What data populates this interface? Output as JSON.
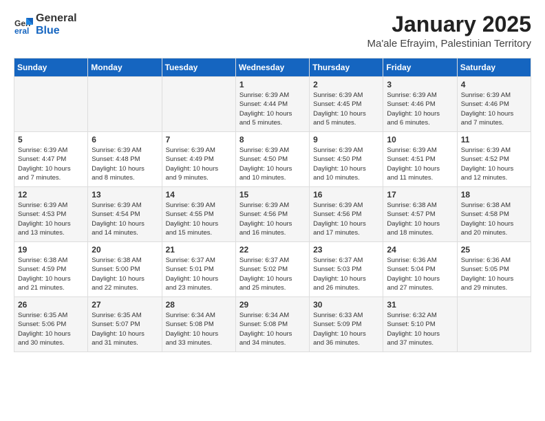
{
  "logo": {
    "general": "General",
    "blue": "Blue"
  },
  "header": {
    "month": "January 2025",
    "location": "Ma'ale Efrayim, Palestinian Territory"
  },
  "weekdays": [
    "Sunday",
    "Monday",
    "Tuesday",
    "Wednesday",
    "Thursday",
    "Friday",
    "Saturday"
  ],
  "weeks": [
    [
      {
        "day": "",
        "info": ""
      },
      {
        "day": "",
        "info": ""
      },
      {
        "day": "",
        "info": ""
      },
      {
        "day": "1",
        "info": "Sunrise: 6:39 AM\nSunset: 4:44 PM\nDaylight: 10 hours\nand 5 minutes."
      },
      {
        "day": "2",
        "info": "Sunrise: 6:39 AM\nSunset: 4:45 PM\nDaylight: 10 hours\nand 5 minutes."
      },
      {
        "day": "3",
        "info": "Sunrise: 6:39 AM\nSunset: 4:46 PM\nDaylight: 10 hours\nand 6 minutes."
      },
      {
        "day": "4",
        "info": "Sunrise: 6:39 AM\nSunset: 4:46 PM\nDaylight: 10 hours\nand 7 minutes."
      }
    ],
    [
      {
        "day": "5",
        "info": "Sunrise: 6:39 AM\nSunset: 4:47 PM\nDaylight: 10 hours\nand 7 minutes."
      },
      {
        "day": "6",
        "info": "Sunrise: 6:39 AM\nSunset: 4:48 PM\nDaylight: 10 hours\nand 8 minutes."
      },
      {
        "day": "7",
        "info": "Sunrise: 6:39 AM\nSunset: 4:49 PM\nDaylight: 10 hours\nand 9 minutes."
      },
      {
        "day": "8",
        "info": "Sunrise: 6:39 AM\nSunset: 4:50 PM\nDaylight: 10 hours\nand 10 minutes."
      },
      {
        "day": "9",
        "info": "Sunrise: 6:39 AM\nSunset: 4:50 PM\nDaylight: 10 hours\nand 10 minutes."
      },
      {
        "day": "10",
        "info": "Sunrise: 6:39 AM\nSunset: 4:51 PM\nDaylight: 10 hours\nand 11 minutes."
      },
      {
        "day": "11",
        "info": "Sunrise: 6:39 AM\nSunset: 4:52 PM\nDaylight: 10 hours\nand 12 minutes."
      }
    ],
    [
      {
        "day": "12",
        "info": "Sunrise: 6:39 AM\nSunset: 4:53 PM\nDaylight: 10 hours\nand 13 minutes."
      },
      {
        "day": "13",
        "info": "Sunrise: 6:39 AM\nSunset: 4:54 PM\nDaylight: 10 hours\nand 14 minutes."
      },
      {
        "day": "14",
        "info": "Sunrise: 6:39 AM\nSunset: 4:55 PM\nDaylight: 10 hours\nand 15 minutes."
      },
      {
        "day": "15",
        "info": "Sunrise: 6:39 AM\nSunset: 4:56 PM\nDaylight: 10 hours\nand 16 minutes."
      },
      {
        "day": "16",
        "info": "Sunrise: 6:39 AM\nSunset: 4:56 PM\nDaylight: 10 hours\nand 17 minutes."
      },
      {
        "day": "17",
        "info": "Sunrise: 6:38 AM\nSunset: 4:57 PM\nDaylight: 10 hours\nand 18 minutes."
      },
      {
        "day": "18",
        "info": "Sunrise: 6:38 AM\nSunset: 4:58 PM\nDaylight: 10 hours\nand 20 minutes."
      }
    ],
    [
      {
        "day": "19",
        "info": "Sunrise: 6:38 AM\nSunset: 4:59 PM\nDaylight: 10 hours\nand 21 minutes."
      },
      {
        "day": "20",
        "info": "Sunrise: 6:38 AM\nSunset: 5:00 PM\nDaylight: 10 hours\nand 22 minutes."
      },
      {
        "day": "21",
        "info": "Sunrise: 6:37 AM\nSunset: 5:01 PM\nDaylight: 10 hours\nand 23 minutes."
      },
      {
        "day": "22",
        "info": "Sunrise: 6:37 AM\nSunset: 5:02 PM\nDaylight: 10 hours\nand 25 minutes."
      },
      {
        "day": "23",
        "info": "Sunrise: 6:37 AM\nSunset: 5:03 PM\nDaylight: 10 hours\nand 26 minutes."
      },
      {
        "day": "24",
        "info": "Sunrise: 6:36 AM\nSunset: 5:04 PM\nDaylight: 10 hours\nand 27 minutes."
      },
      {
        "day": "25",
        "info": "Sunrise: 6:36 AM\nSunset: 5:05 PM\nDaylight: 10 hours\nand 29 minutes."
      }
    ],
    [
      {
        "day": "26",
        "info": "Sunrise: 6:35 AM\nSunset: 5:06 PM\nDaylight: 10 hours\nand 30 minutes."
      },
      {
        "day": "27",
        "info": "Sunrise: 6:35 AM\nSunset: 5:07 PM\nDaylight: 10 hours\nand 31 minutes."
      },
      {
        "day": "28",
        "info": "Sunrise: 6:34 AM\nSunset: 5:08 PM\nDaylight: 10 hours\nand 33 minutes."
      },
      {
        "day": "29",
        "info": "Sunrise: 6:34 AM\nSunset: 5:08 PM\nDaylight: 10 hours\nand 34 minutes."
      },
      {
        "day": "30",
        "info": "Sunrise: 6:33 AM\nSunset: 5:09 PM\nDaylight: 10 hours\nand 36 minutes."
      },
      {
        "day": "31",
        "info": "Sunrise: 6:32 AM\nSunset: 5:10 PM\nDaylight: 10 hours\nand 37 minutes."
      },
      {
        "day": "",
        "info": ""
      }
    ]
  ]
}
